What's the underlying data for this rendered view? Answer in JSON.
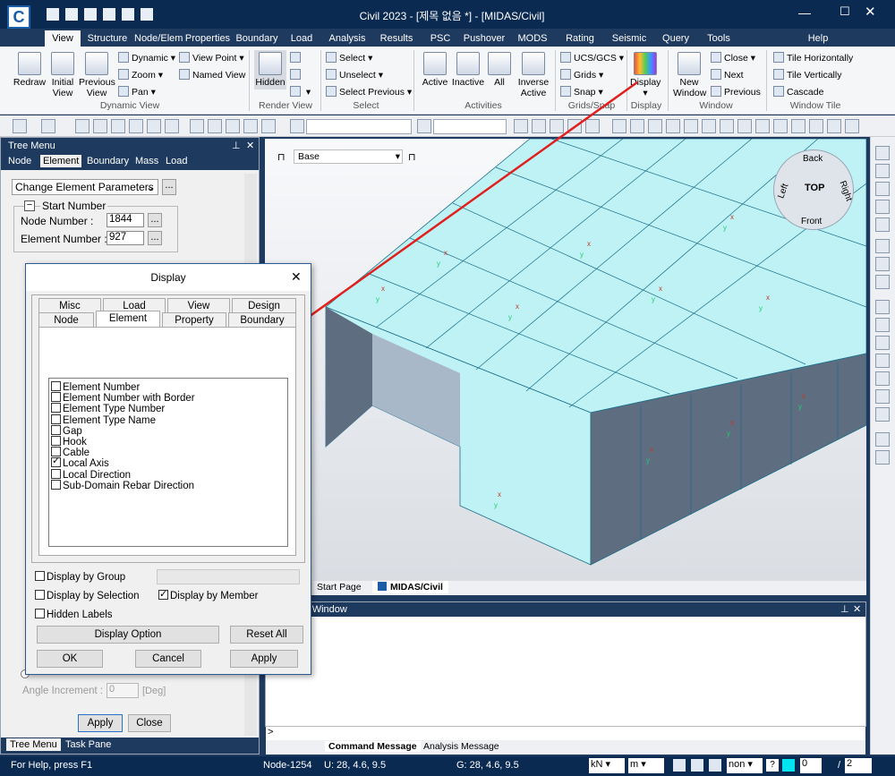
{
  "app": {
    "title": "Civil 2023 - [제목 없음 *] - [MIDAS/Civil]",
    "logo": "C"
  },
  "ribbon_tabs": [
    "View",
    "Structure",
    "Node/Elem",
    "Properties",
    "Boundary",
    "Load",
    "Analysis",
    "Results",
    "PSC",
    "Pushover",
    "MODS",
    "Rating",
    "Seismic Per",
    "Query",
    "Tools"
  ],
  "help_label": "Help",
  "ribbon": {
    "dynamic_view": {
      "label": "Dynamic View",
      "redraw": "Redraw",
      "initial_view": "Initial View",
      "previous_view": "Previous View",
      "dynamic": "Dynamic",
      "zoom": "Zoom",
      "pan": "Pan",
      "view_point": "View Point",
      "named_view": "Named View"
    },
    "render_view": {
      "label": "Render View",
      "hidden": "Hidden"
    },
    "select": {
      "label": "Select",
      "select": "Select",
      "unselect": "Unselect",
      "select_previous": "Select Previous"
    },
    "activities": {
      "label": "Activities",
      "active": "Active",
      "inactive": "Inactive",
      "all": "All",
      "inverse_active": "Inverse Active"
    },
    "grids_snap": {
      "label": "Grids/Snap",
      "ucs": "UCS/GCS",
      "grids": "Grids",
      "snap": "Snap"
    },
    "display": {
      "label": "Display",
      "display": "Display"
    },
    "window": {
      "label": "Window",
      "new_window": "New Window",
      "close": "Close",
      "next": "Next",
      "previous": "Previous"
    },
    "window_tile": {
      "label": "Window Tile",
      "tile_h": "Tile Horizontally",
      "tile_v": "Tile Vertically",
      "cascade": "Cascade"
    }
  },
  "tree_menu": {
    "title": "Tree Menu",
    "tabs": [
      "Node",
      "Element",
      "Boundary",
      "Mass",
      "Load"
    ],
    "active_tab": "Element",
    "function_select": "Change Element Parameters",
    "start_number_label": "Start Number",
    "node_number_label": "Node Number :",
    "node_number_value": "1844",
    "element_number_label": "Element Number :",
    "element_number_value": "927",
    "angle_increment_label": "Angle Increment :",
    "angle_increment_value": "0",
    "angle_unit": "[Deg]",
    "apply": "Apply",
    "close": "Close",
    "bottom_tabs": [
      "Tree Menu",
      "Task Pane"
    ]
  },
  "display_dialog": {
    "title": "Display",
    "tabs_row1": [
      "Misc",
      "Load",
      "View",
      "Design"
    ],
    "tabs_row2": [
      "Node",
      "Element",
      "Property",
      "Boundary"
    ],
    "selected_tab": "Element",
    "items": [
      {
        "label": "Element Number",
        "checked": false
      },
      {
        "label": "Element Number with Border",
        "checked": false
      },
      {
        "label": "Element Type Number",
        "checked": false
      },
      {
        "label": "Element Type Name",
        "checked": false
      },
      {
        "label": "Gap",
        "checked": false
      },
      {
        "label": "Hook",
        "checked": false
      },
      {
        "label": "Cable",
        "checked": false
      },
      {
        "label": "Local Axis",
        "checked": true
      },
      {
        "label": "Local Direction",
        "checked": false
      },
      {
        "label": "Sub-Domain Rebar Direction",
        "checked": false
      }
    ],
    "display_by_group": "Display by Group",
    "display_by_selection": "Display by Selection",
    "display_by_member": "Display by Member",
    "hidden_labels": "Hidden Labels",
    "display_option": "Display Option",
    "reset_all": "Reset All",
    "ok": "OK",
    "cancel": "Cancel",
    "apply": "Apply"
  },
  "viewport": {
    "base_select": "Base",
    "tabs": [
      "Start Page",
      "MIDAS/Civil"
    ],
    "nav_cube": {
      "back": "Back",
      "top": "TOP",
      "front": "Front",
      "left": "Left",
      "right": "Right"
    },
    "model_color": "#bff2f4",
    "wall_color": "#5f6d80"
  },
  "message_window": {
    "title": "Message Window",
    "tabs": [
      "Command Message",
      "Analysis Message"
    ]
  },
  "status": {
    "help": "For Help, press F1",
    "node": "Node-1254",
    "u": "U: 28, 4.6, 9.5",
    "g": "G: 28, 4.6, 9.5",
    "force_unit": "kN",
    "length_unit": "m",
    "snap_mode": "non",
    "page_current": "0",
    "page_sep": "/",
    "page_total": "2"
  }
}
